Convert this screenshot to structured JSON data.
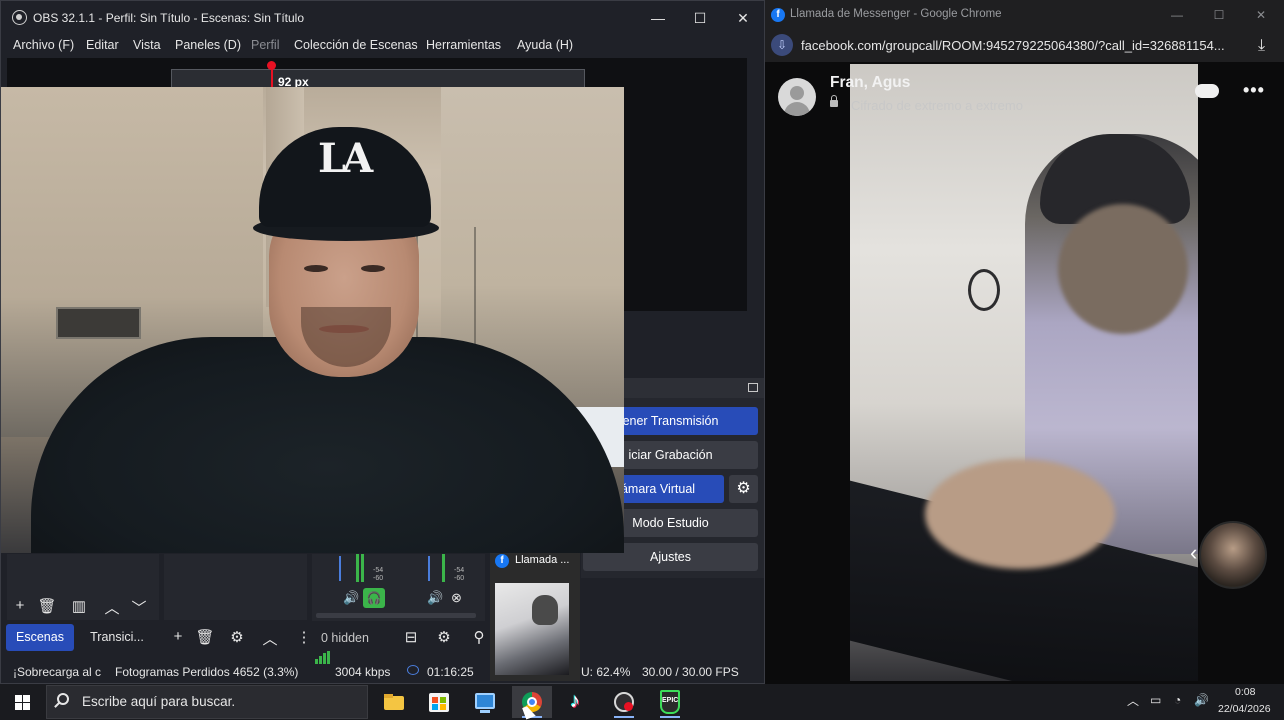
{
  "obs": {
    "title": "OBS 32.1.1 - Perfil: Sin Título - Escenas: Sin Título",
    "window_controls": {
      "minimize": "—",
      "maximize": "☐",
      "close": "✕"
    },
    "menu": [
      {
        "label": "Archivo (F)",
        "enabled": true
      },
      {
        "label": "Editar",
        "enabled": true
      },
      {
        "label": "Vista",
        "enabled": true
      },
      {
        "label": "Paneles (D)",
        "enabled": true
      },
      {
        "label": "Perfil",
        "enabled": false
      },
      {
        "label": "Colección de Escenas",
        "enabled": true
      },
      {
        "label": "Herramientas",
        "enabled": true
      },
      {
        "label": "Ayuda (H)",
        "enabled": true
      }
    ],
    "preview": {
      "px_label": "92 px"
    },
    "controls": {
      "stream": "ener Transmisión",
      "record": "iciar Grabación",
      "virtual_cam": "Cámara Virtual",
      "studio_mode": "Modo Estudio",
      "settings": "Ajustes"
    },
    "mixer": {
      "ticks": [
        "-54",
        "-60"
      ]
    },
    "tabs": {
      "scenes": "Escenas",
      "transitions": "Transici..."
    },
    "sources_hidden": "0 hidden",
    "status": {
      "overload": "¡Sobrecarga al c",
      "dropped_frames": "Fotogramas Perdidos 4652 (3.3%)",
      "bitrate": "3004 kbps",
      "stream_time": "01:16:25",
      "cpu": "U: 62.4%",
      "fps": "30.00 / 30.00 FPS"
    }
  },
  "taskbar_preview": {
    "label": "Llamada ..."
  },
  "chrome": {
    "title": "Llamada de Messenger - Google Chrome",
    "url": "facebook.com/groupcall/ROOM:945279225064380/?call_id=326881154...",
    "caller_name": "Fran, Agus",
    "encryption_label": "Cifrado de extremo a extremo",
    "more_icon": "•••",
    "brand_color": "#1877f2"
  },
  "taskbar": {
    "search_placeholder": "Escribe aquí para buscar.",
    "apps": [
      "file-explorer-icon",
      "microsoft-store-icon",
      "remote-desktop-icon",
      "chrome-icon",
      "tiktok-icon",
      "obs-icon",
      "epic-games-icon"
    ],
    "clock_time": "0:08",
    "clock_date": "22/04/2026"
  },
  "colors": {
    "obs_accent": "#284cb8",
    "meter_green": "#3bb54a"
  }
}
